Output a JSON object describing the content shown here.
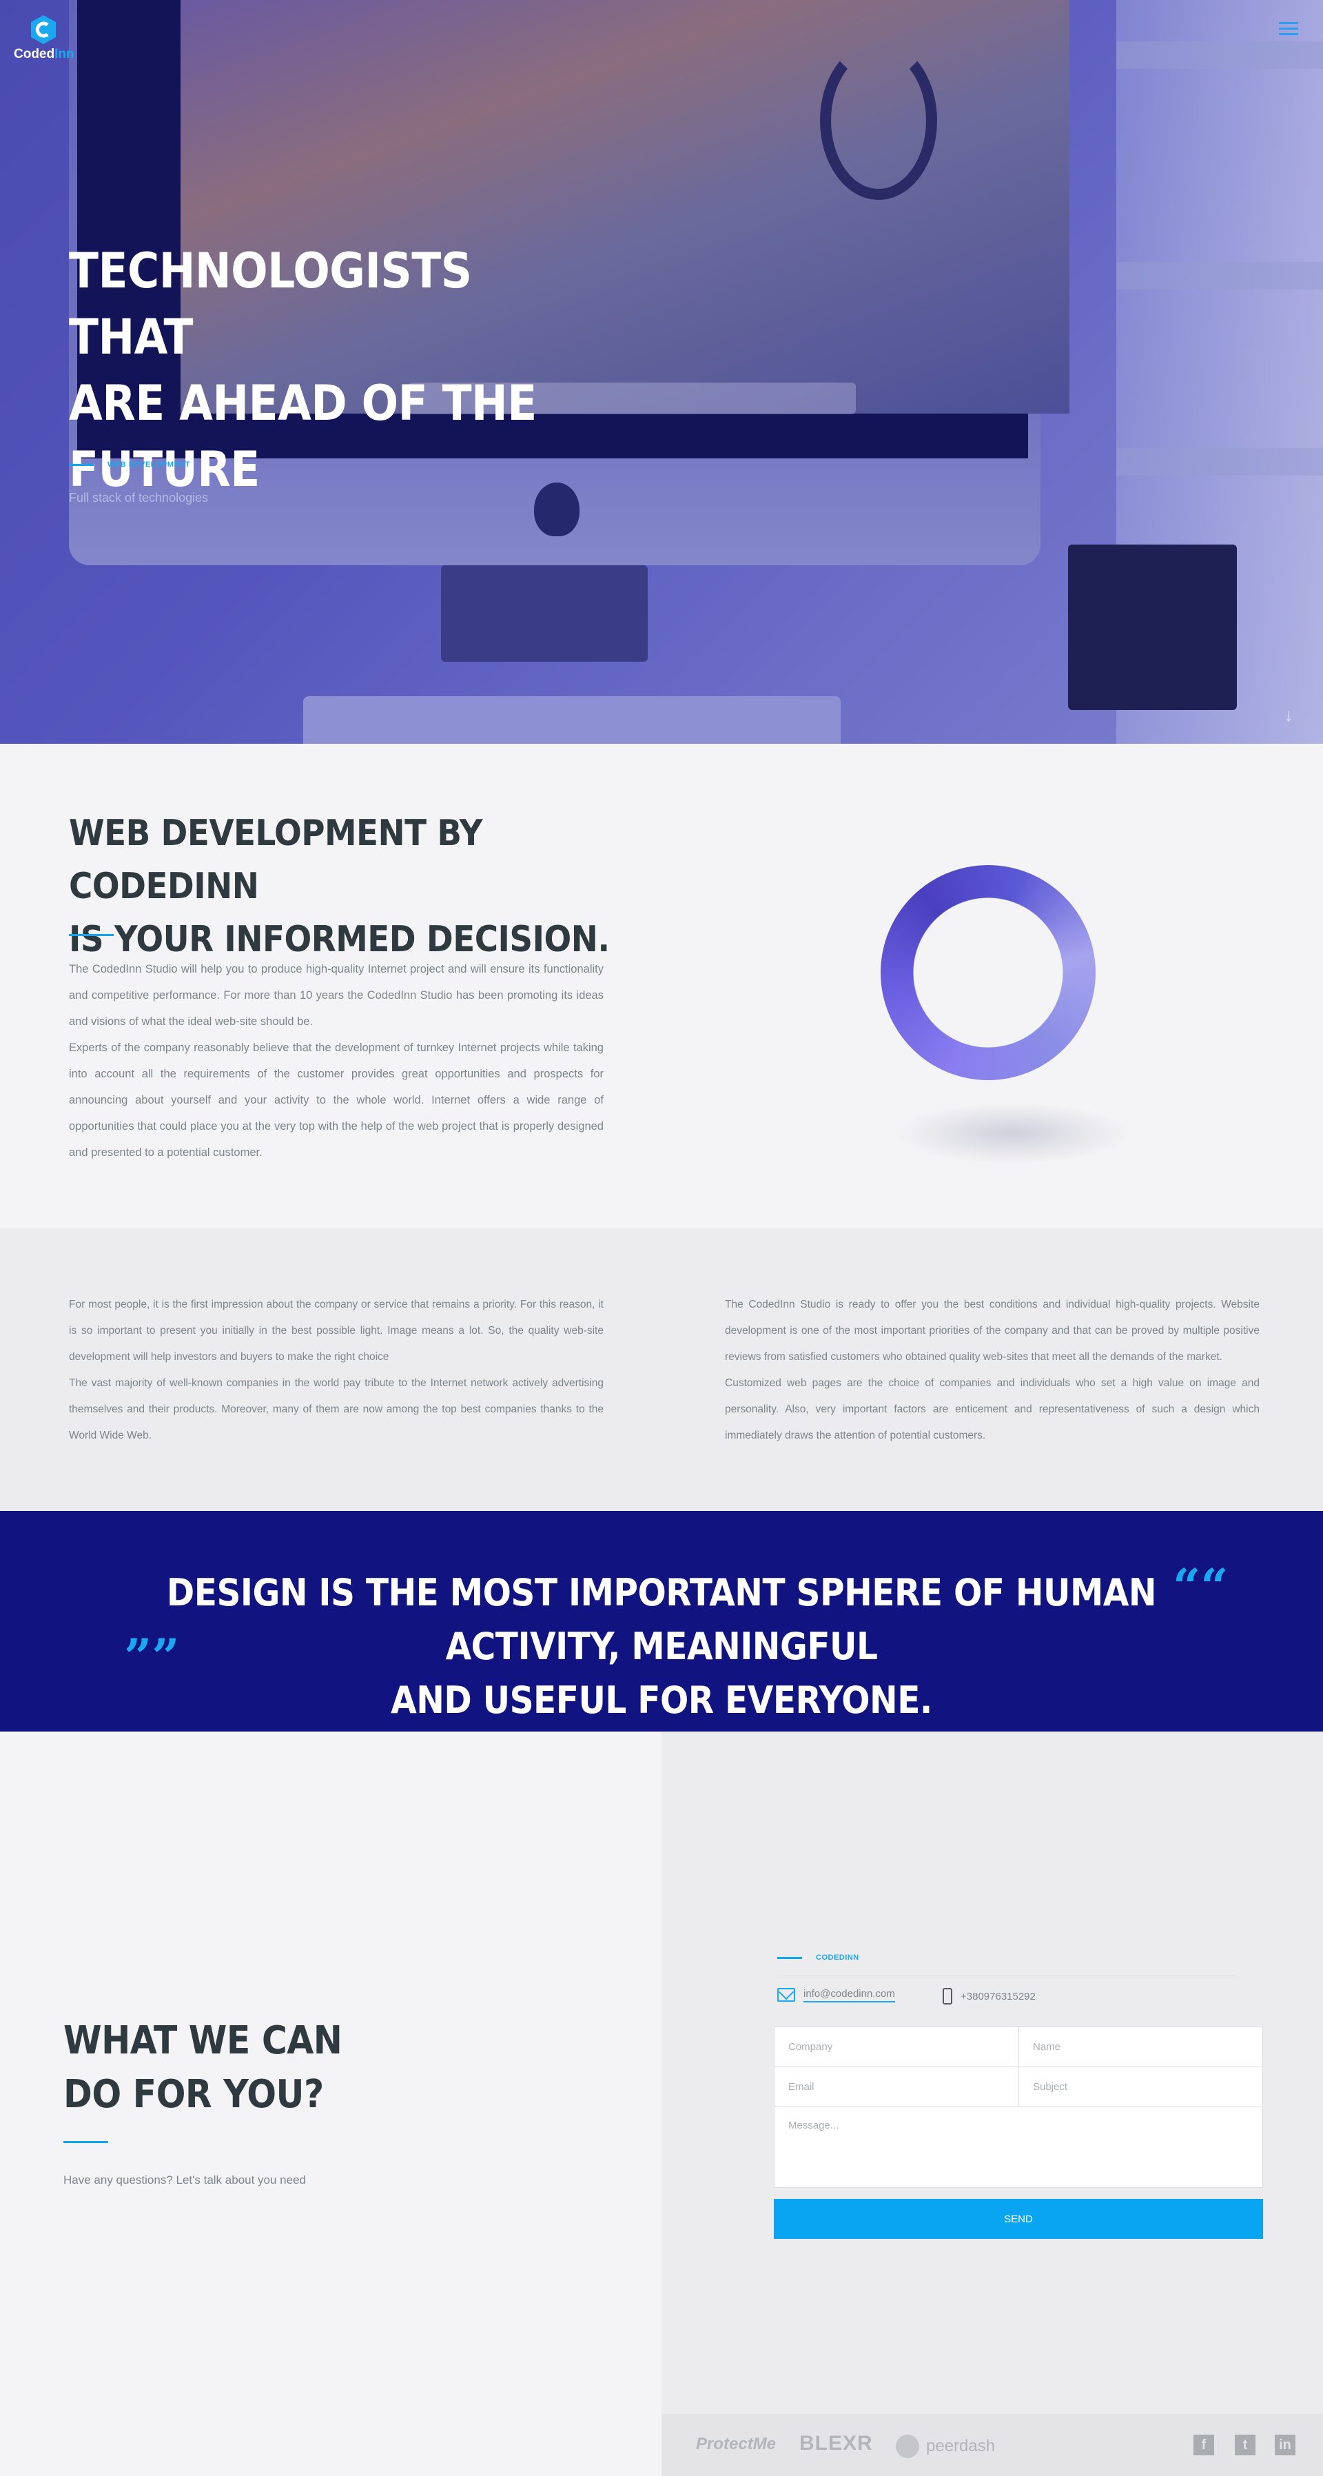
{
  "header": {
    "logo_brand": "Coded",
    "logo_accent": "Inn"
  },
  "hero": {
    "title_line1": "TECHNOLOGISTS THAT",
    "title_line2": "ARE AHEAD OF THE",
    "title_line3": "FUTURE",
    "tag": "WEB DEVELOPMENT",
    "subtitle": "Full stack of technologies"
  },
  "about": {
    "title_line1": "WEB DEVELOPMENT BY CODEDINN",
    "title_line2": "IS YOUR INFORMED DECISION.",
    "paragraph1": "The CodedInn Studio will help you to produce high-quality Internet project and will ensure its functionality and competitive performance. For more than 10 years the CodedInn Studio has been promoting its ideas and visions of what the ideal web-site should be.",
    "paragraph2": "Experts of the company reasonably believe that the development of turnkey Internet projects while taking into account all the requirements of the customer provides great opportunities and prospects for announcing about yourself and your activity to the whole world. Internet offers a wide range of opportunities that could place you at the very top with the help of the web project that is properly designed and presented to a potential customer."
  },
  "columns": {
    "left_p1": "For most people, it is the first impression about the company or service that remains a priority. For this reason, it is so important to present you initially in the best possible light. Image means a lot. So, the quality web-site development will help investors and buyers to make the right choice",
    "left_p2": "The vast majority of well-known companies in the world pay tribute to the Internet network actively advertising themselves and their products. Moreover, many of them are now among the top best companies thanks to the World Wide Web.",
    "right_p1": "The CodedInn Studio is ready to offer you the best conditions and individual high-quality projects. Website development is one of the most important priorities of the company and that can be proved by multiple positive reviews from satisfied customers who obtained quality web-sites that meet all the demands of the market.",
    "right_p2": "Customized web pages are the choice of companies and individuals who set a high value on image and personality. Also, very important factors are enticement and representativeness of such a design which immediately draws the attention of potential customers."
  },
  "quote": {
    "line1": "DESIGN IS THE MOST IMPORTANT SPHERE OF HUMAN ACTIVITY, MEANINGFUL",
    "line2": "AND USEFUL FOR EVERYONE.",
    "open_mark": "““",
    "close_mark": "””"
  },
  "contact": {
    "title_line1": "WHAT WE CAN",
    "title_line2": "DO FOR YOU?",
    "subtitle": "Have any questions? Let's talk about you need",
    "tag": "CODEDINN",
    "email": "info@codedinn.com",
    "phone": "+380976315292",
    "form": {
      "company_placeholder": "Company",
      "name_placeholder": "Name",
      "email_placeholder": "Email",
      "subject_placeholder": "Subject",
      "message_placeholder": "Message...",
      "send_label": "SEND"
    }
  },
  "footer": {
    "partners": [
      "ProtectMe",
      "BLEXR",
      "peerdash"
    ],
    "social": [
      "f",
      "t",
      "in"
    ]
  },
  "icons": [
    "logo-hex-icon",
    "menu-icon",
    "arrow-down-icon",
    "envelope-icon",
    "phone-icon",
    "facebook-icon",
    "twitter-icon",
    "linkedin-icon"
  ],
  "colors": {
    "accent": "#0aa5f2",
    "quote_bg": "#111380",
    "heading": "#2f3a40",
    "body_text": "#7c858b"
  }
}
